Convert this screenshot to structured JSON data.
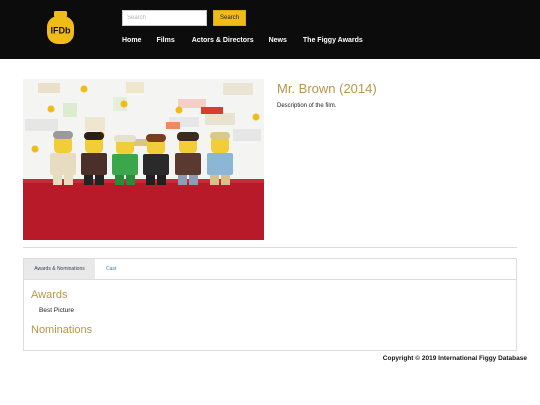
{
  "header": {
    "logo_text": "IFDb",
    "search": {
      "placeholder": "Search",
      "value": ""
    },
    "search_button": "Search",
    "nav": [
      {
        "label": "Home"
      },
      {
        "label": "Films"
      },
      {
        "label": "Actors & Directors"
      },
      {
        "label": "News"
      },
      {
        "label": "The Figgy Awards"
      }
    ]
  },
  "film": {
    "title": "Mr. Brown (2014)",
    "description": "Description of the film."
  },
  "tabs": [
    {
      "label": "Awards & Nominations",
      "active": true
    },
    {
      "label": "Cast",
      "active": false
    }
  ],
  "awards": {
    "heading": "Awards",
    "items": [
      "Best Picture"
    ]
  },
  "nominations": {
    "heading": "Nominations"
  },
  "footer": {
    "copyright": "Copyright © 2019 International Figgy Database"
  },
  "colors": {
    "header_bg": "#0c0c0c",
    "accent": "#f0bc17",
    "heading_gold": "#b8954a",
    "link_blue": "#3a79c4"
  }
}
